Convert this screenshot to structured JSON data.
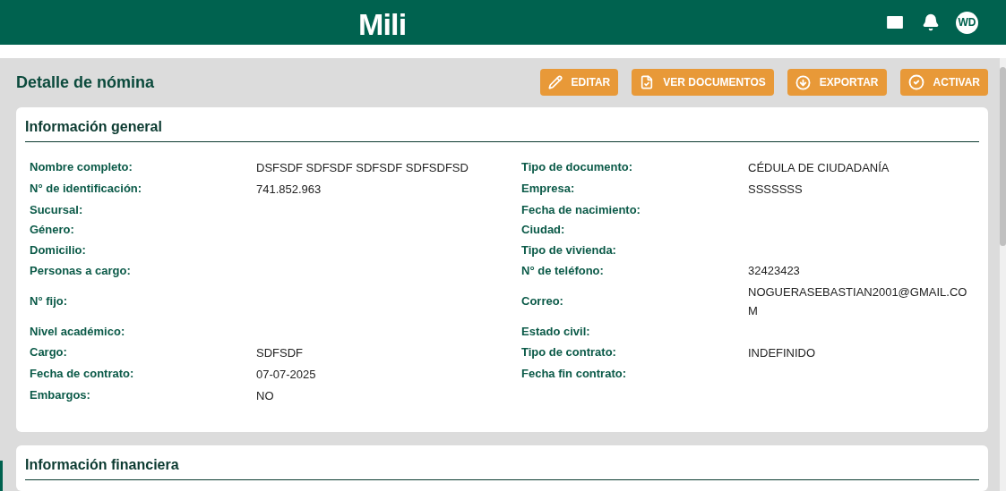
{
  "header": {
    "logo": "Mili",
    "avatar": "WD"
  },
  "page_title": "Detalle de nómina",
  "actions": [
    {
      "kind": "edit",
      "label": "EDITAR"
    },
    {
      "kind": "documents",
      "label": "VER DOCUMENTOS"
    },
    {
      "kind": "export",
      "label": "EXPORTAR"
    },
    {
      "kind": "activate",
      "label": "ACTIVAR"
    }
  ],
  "general": {
    "title": "Información general",
    "rows": [
      [
        {
          "label": "Nombre completo:",
          "value": "DSFSDF SDFSDF SDFSDF SDFSDFSD"
        },
        {
          "label": "Tipo de documento:",
          "value": "CÉDULA DE CIUDADANÍA"
        }
      ],
      [
        {
          "label": "N° de identificación:",
          "value": "741.852.963"
        },
        {
          "label": "Empresa:",
          "value": "SSSSSSS"
        }
      ],
      [
        {
          "label": "Sucursal:"
        },
        {
          "label": "Fecha de nacimiento:"
        }
      ],
      [
        {
          "label": "Género:"
        },
        {
          "label": "Ciudad:"
        }
      ],
      [
        {
          "label": "Domicilio:"
        },
        {
          "label": "Tipo de vivienda:"
        }
      ],
      [
        {
          "label": "Personas a cargo:"
        },
        {
          "label": "N° de teléfono:",
          "value": "32423423"
        }
      ],
      [
        {
          "label": "N° fijo:"
        },
        {
          "label": "Correo:",
          "value": "NOGUERASEBASTIAN2001@GMAIL.COM"
        }
      ],
      [
        {
          "label": "Nivel académico:"
        },
        {
          "label": "Estado civil:"
        }
      ],
      [
        {
          "label": "Cargo:",
          "value": "SDFSDF"
        },
        {
          "label": "Tipo de contrato:",
          "value": "INDEFINIDO"
        }
      ],
      [
        {
          "label": "Fecha de contrato:",
          "value": "07-07-2025"
        },
        {
          "label": "Fecha fin contrato:"
        }
      ],
      [
        {
          "label": "Embargos:",
          "value": "NO"
        }
      ]
    ]
  },
  "financial": {
    "title": "Información financiera"
  }
}
